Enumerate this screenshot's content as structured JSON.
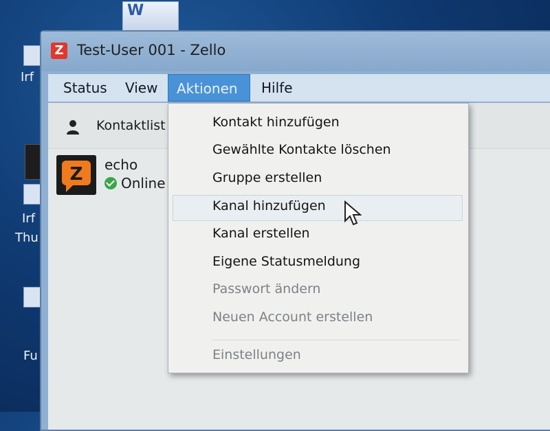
{
  "desktop": {
    "left_labels": [
      "Irf",
      "Irf",
      "Thu",
      "Fu"
    ]
  },
  "window": {
    "title": "Test-User 001 - Zello",
    "logo_letter": "Z"
  },
  "menu": {
    "items": [
      {
        "label": "Status"
      },
      {
        "label": "View"
      },
      {
        "label": "Aktionen"
      },
      {
        "label": "Hilfe"
      }
    ]
  },
  "toolbar": {
    "contactlist_label": "Kontaktlist"
  },
  "contact": {
    "name": "echo",
    "status": "Online"
  },
  "dropdown": {
    "items": [
      {
        "label": "Kontakt hinzufügen",
        "enabled": true
      },
      {
        "label": "Gewählte Kontakte löschen",
        "enabled": true
      },
      {
        "label": "Gruppe erstellen",
        "enabled": true
      },
      {
        "label": "Kanal hinzufügen",
        "enabled": true,
        "highlighted": true
      },
      {
        "label": "Kanal erstellen",
        "enabled": true
      },
      {
        "label": "Eigene Statusmeldung",
        "enabled": true
      },
      {
        "label": "Passwort ändern",
        "enabled": false
      },
      {
        "label": "Neuen Account erstellen",
        "enabled": false
      },
      {
        "label": "Einstellungen",
        "enabled": false
      }
    ]
  },
  "colors": {
    "accent": "#4a92d8",
    "status_online": "#38a74a",
    "zello_brand": "#e2372b"
  }
}
